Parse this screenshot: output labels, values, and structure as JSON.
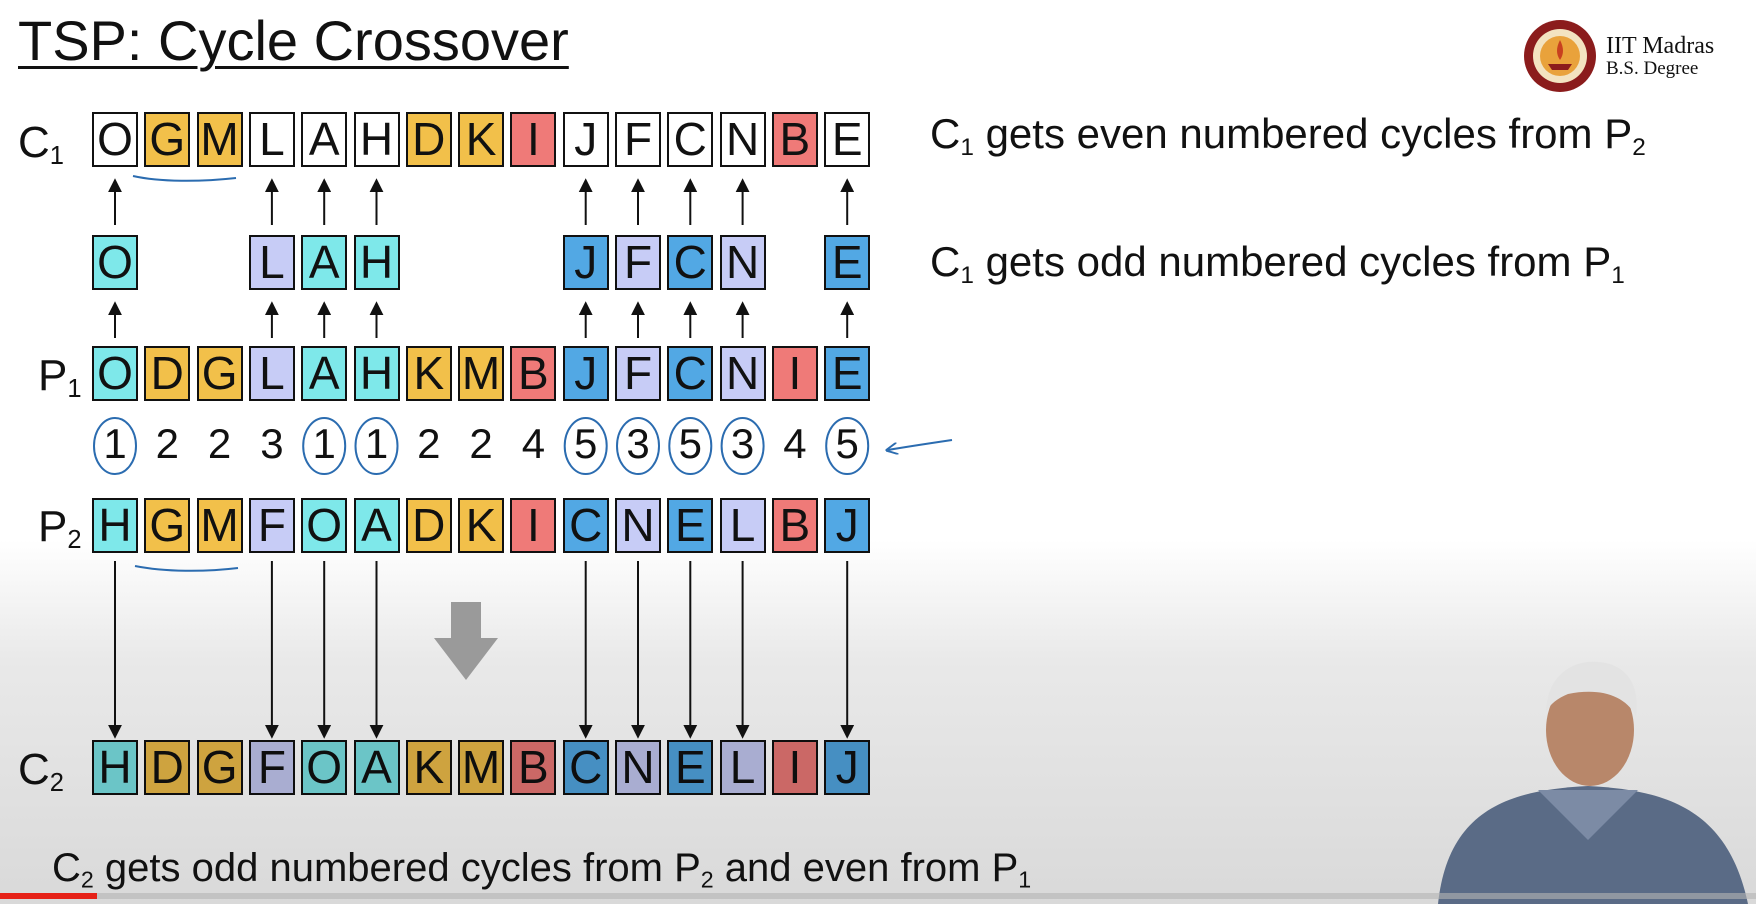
{
  "title": "TSP: Cycle Crossover",
  "logo": {
    "line1": "IIT Madras",
    "line2": "B.S. Degree"
  },
  "labels": {
    "c1": {
      "base": "C",
      "sub": "1"
    },
    "p1": {
      "base": "P",
      "sub": "1"
    },
    "p2": {
      "base": "P",
      "sub": "2"
    },
    "c2": {
      "base": "C",
      "sub": "2"
    }
  },
  "notes": {
    "c1_even": {
      "t1": "C",
      "s1": "1",
      "t2": " gets even numbered cycles from P",
      "s2": "2"
    },
    "c1_odd": {
      "t1": "C",
      "s1": "1",
      "t2": " gets odd numbered cycles from P",
      "s2": "1"
    },
    "c2": {
      "t1": "C",
      "s1": "2",
      "t2": " gets odd numbered cycles from P",
      "s2": "2",
      "t3": " and even from P",
      "s3": "1"
    }
  },
  "colors": {
    "cycle1": "#7ee8ea",
    "cycle2": "#f2c04a",
    "cycle3": "#c7ccf6",
    "cycle4": "#ef7a78",
    "cycle5": "#52a8e4",
    "white": "#ffffff",
    "annotation": "#2b6cb0",
    "arrow_big": "#9a9a9a"
  },
  "cycle_numbers": [
    "1",
    "2",
    "2",
    "3",
    "1",
    "1",
    "2",
    "2",
    "4",
    "5",
    "3",
    "5",
    "3",
    "4",
    "5"
  ],
  "circled_positions": [
    0,
    4,
    5,
    9,
    10,
    11,
    12,
    14
  ],
  "rows": {
    "c1": [
      "O",
      "G",
      "M",
      "L",
      "A",
      "H",
      "D",
      "K",
      "I",
      "J",
      "F",
      "C",
      "N",
      "B",
      "E"
    ],
    "c1_fill": [
      "white",
      "cycle2",
      "cycle2",
      "white",
      "white",
      "white",
      "cycle2",
      "cycle2",
      "cycle4",
      "white",
      "white",
      "white",
      "white",
      "cycle4",
      "white"
    ],
    "mid": [
      "O",
      "",
      "",
      "L",
      "A",
      "H",
      "",
      "",
      "",
      "J",
      "F",
      "C",
      "N",
      "",
      "E"
    ],
    "mid_fill": [
      "cycle1",
      "",
      "",
      "cycle3",
      "cycle1",
      "cycle1",
      "",
      "",
      "",
      "cycle5",
      "cycle3",
      "cycle5",
      "cycle3",
      "",
      "cycle5"
    ],
    "p1": [
      "O",
      "D",
      "G",
      "L",
      "A",
      "H",
      "K",
      "M",
      "B",
      "J",
      "F",
      "C",
      "N",
      "I",
      "E"
    ],
    "p1_fill": [
      "cycle1",
      "cycle2",
      "cycle2",
      "cycle3",
      "cycle1",
      "cycle1",
      "cycle2",
      "cycle2",
      "cycle4",
      "cycle5",
      "cycle3",
      "cycle5",
      "cycle3",
      "cycle4",
      "cycle5"
    ],
    "p2": [
      "H",
      "G",
      "M",
      "F",
      "O",
      "A",
      "D",
      "K",
      "I",
      "C",
      "N",
      "E",
      "L",
      "B",
      "J"
    ],
    "p2_fill": [
      "cycle1",
      "cycle2",
      "cycle2",
      "cycle3",
      "cycle1",
      "cycle1",
      "cycle2",
      "cycle2",
      "cycle4",
      "cycle5",
      "cycle3",
      "cycle5",
      "cycle3",
      "cycle4",
      "cycle5"
    ],
    "c2": [
      "H",
      "D",
      "G",
      "F",
      "O",
      "A",
      "K",
      "M",
      "B",
      "C",
      "N",
      "E",
      "L",
      "I",
      "J"
    ],
    "c2_fill": [
      "cycle1",
      "cycle2",
      "cycle2",
      "cycle3",
      "cycle1",
      "cycle1",
      "cycle2",
      "cycle2",
      "cycle4",
      "cycle5",
      "cycle3",
      "cycle5",
      "cycle3",
      "cycle4",
      "cycle5"
    ]
  },
  "video_progress": 0.055
}
